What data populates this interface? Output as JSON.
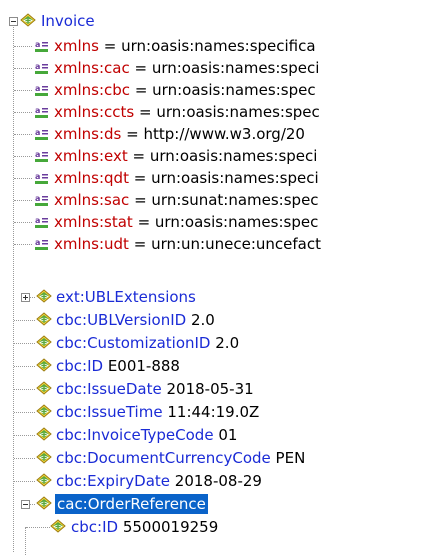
{
  "root": {
    "name": "Invoice"
  },
  "attributes": [
    {
      "name": "xmlns",
      "value": "urn:oasis:names:specifica"
    },
    {
      "name": "xmlns:cac",
      "value": "urn:oasis:names:speci"
    },
    {
      "name": "xmlns:cbc",
      "value": "urn:oasis:names:spec"
    },
    {
      "name": "xmlns:ccts",
      "value": "urn:oasis:names:spec"
    },
    {
      "name": "xmlns:ds",
      "value": "http://www.w3.org/20"
    },
    {
      "name": "xmlns:ext",
      "value": "urn:oasis:names:speci"
    },
    {
      "name": "xmlns:qdt",
      "value": "urn:oasis:names:speci"
    },
    {
      "name": "xmlns:sac",
      "value": "urn:sunat:names:spec"
    },
    {
      "name": "xmlns:stat",
      "value": "urn:oasis:names:spec"
    },
    {
      "name": "xmlns:udt",
      "value": "urn:un:unece:uncefact"
    }
  ],
  "elements": [
    {
      "name": "ext:UBLExtensions",
      "value": ""
    },
    {
      "name": "cbc:UBLVersionID",
      "value": "2.0"
    },
    {
      "name": "cbc:CustomizationID",
      "value": "2.0"
    },
    {
      "name": "cbc:ID",
      "value": "E001-888"
    },
    {
      "name": "cbc:IssueDate",
      "value": "2018-05-31"
    },
    {
      "name": "cbc:IssueTime",
      "value": "11:44:19.0Z"
    },
    {
      "name": "cbc:InvoiceTypeCode",
      "value": "01"
    },
    {
      "name": "cbc:DocumentCurrencyCode",
      "value": "PEN"
    },
    {
      "name": "cbc:ExpiryDate",
      "value": "2018-08-29"
    },
    {
      "name": "cac:OrderReference",
      "value": ""
    }
  ],
  "child": {
    "name": "cbc:ID",
    "value": "5500019259"
  },
  "icons": {
    "element": "xml-element-icon",
    "attribute": "xml-attribute-icon"
  },
  "colors": {
    "attribute_name": "#c00000",
    "element_name": "#1a2bd6",
    "selection": "#0a63c9"
  }
}
